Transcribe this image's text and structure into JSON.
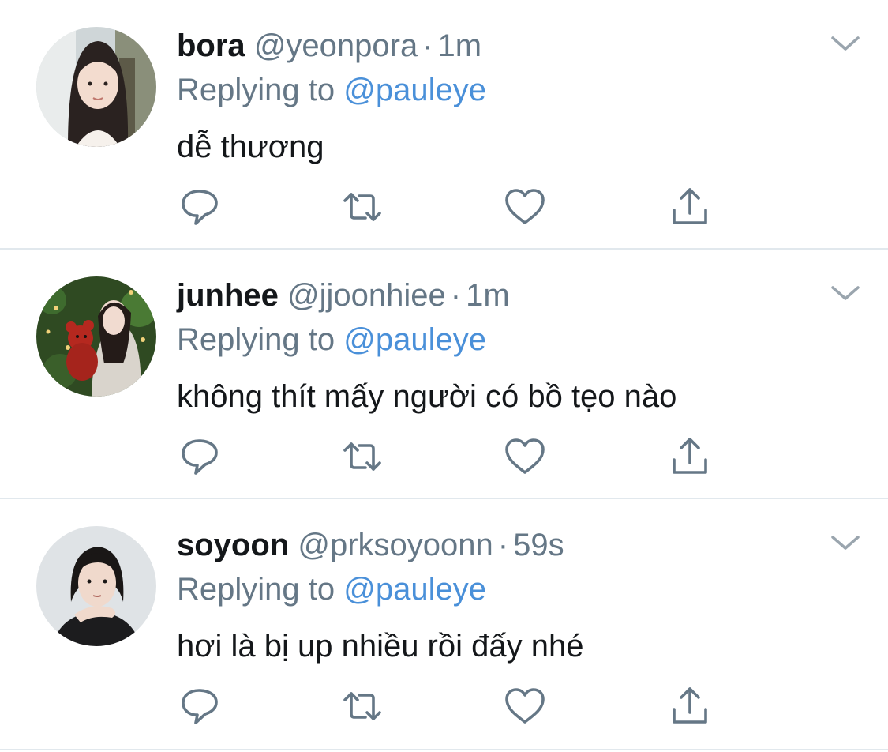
{
  "reply_prefix": "Replying to ",
  "colors": {
    "text_primary": "#14171a",
    "text_secondary": "#657786",
    "link": "#4a90d9",
    "icon": "#657786",
    "divider": "#e1e8ed"
  },
  "tweets": [
    {
      "display_name": "bora",
      "handle": "@yeonpora",
      "separator": "·",
      "time": "1m",
      "reply_to": "@pauleye",
      "text": "dễ thương",
      "icons": [
        "reply-icon",
        "retweet-icon",
        "like-icon",
        "share-icon"
      ]
    },
    {
      "display_name": "junhee",
      "handle": "@jjoonhiee",
      "separator": "·",
      "time": "1m",
      "reply_to": "@pauleye",
      "text": "không thít mấy người có bồ tẹo nào",
      "icons": [
        "reply-icon",
        "retweet-icon",
        "like-icon",
        "share-icon"
      ]
    },
    {
      "display_name": "soyoon",
      "handle": "@prksoyoonn",
      "separator": "·",
      "time": "59s",
      "reply_to": "@pauleye",
      "text": "hơi là bị up nhiều rồi đấy nhé",
      "icons": [
        "reply-icon",
        "retweet-icon",
        "like-icon",
        "share-icon"
      ]
    }
  ]
}
